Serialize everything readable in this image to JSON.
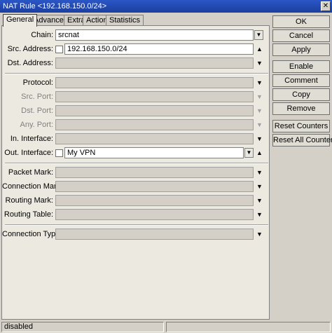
{
  "window": {
    "title": "NAT Rule <192.168.150.0/24>",
    "close_glyph": "✕"
  },
  "tabs": [
    {
      "label": "General",
      "active": true
    },
    {
      "label": "Advanced",
      "active": false
    },
    {
      "label": "Extra",
      "active": false
    },
    {
      "label": "Action",
      "active": false
    },
    {
      "label": "Statistics",
      "active": false
    }
  ],
  "fields": {
    "chain": {
      "label": "Chain:",
      "value": "srcnat"
    },
    "src_address": {
      "label": "Src. Address:",
      "value": "192.168.150.0/24"
    },
    "dst_address": {
      "label": "Dst. Address:",
      "value": ""
    },
    "protocol": {
      "label": "Protocol:",
      "value": ""
    },
    "src_port": {
      "label": "Src. Port:",
      "value": ""
    },
    "dst_port": {
      "label": "Dst. Port:",
      "value": ""
    },
    "any_port": {
      "label": "Any. Port:",
      "value": ""
    },
    "in_interface": {
      "label": "In. Interface:",
      "value": ""
    },
    "out_interface": {
      "label": "Out. Interface:",
      "value": "My VPN"
    },
    "packet_mark": {
      "label": "Packet Mark:",
      "value": ""
    },
    "connection_mark": {
      "label": "Connection Mark:",
      "value": ""
    },
    "routing_mark": {
      "label": "Routing Mark:",
      "value": ""
    },
    "routing_table": {
      "label": "Routing Table:",
      "value": ""
    },
    "connection_type": {
      "label": "Connection Type:",
      "value": ""
    }
  },
  "buttons": {
    "ok": "OK",
    "cancel": "Cancel",
    "apply": "Apply",
    "enable": "Enable",
    "comment": "Comment",
    "copy": "Copy",
    "remove": "Remove",
    "reset_counters": "Reset Counters",
    "reset_all_counters": "Reset All Counters"
  },
  "glyphs": {
    "up": "▲",
    "down": "▼",
    "dropdown": "▼"
  },
  "status": {
    "text": "disabled"
  }
}
